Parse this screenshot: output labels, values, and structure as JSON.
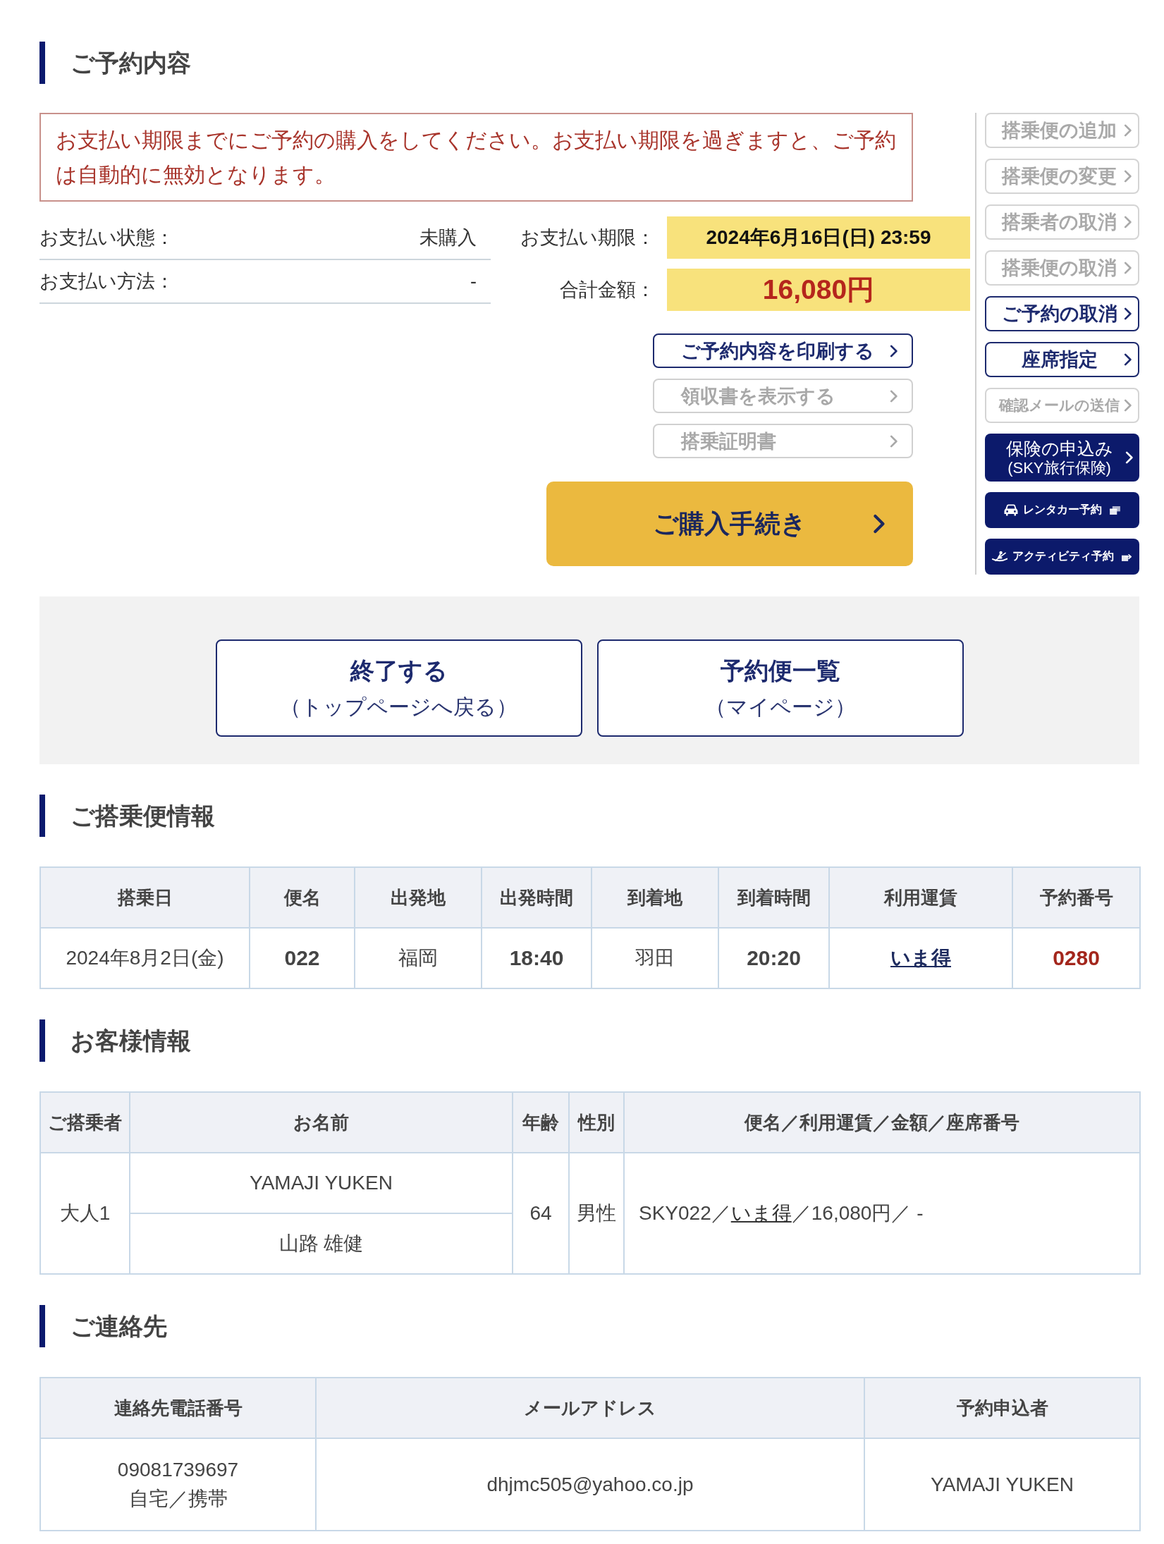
{
  "reservation": {
    "heading": "ご予約内容",
    "notice": "お支払い期限までにご予約の購入をしてください。お支払い期限を過ぎますと、ご予約は自動的に無効となります。",
    "payment_fields": [
      {
        "label": "お支払い状態：",
        "value": "未購入"
      },
      {
        "label": "お支払い方法：",
        "value": "-"
      }
    ],
    "deadline": {
      "label": "お支払い期限：",
      "value": "2024年6月16日(日) 23:59"
    },
    "total": {
      "label": "合計金額：",
      "value": "16,080円"
    },
    "document_buttons": [
      {
        "label": "ご予約内容を印刷する",
        "disabled": false
      },
      {
        "label": "領収書を表示する",
        "disabled": true
      },
      {
        "label": "搭乗証明書",
        "disabled": true
      }
    ],
    "purchase_button": {
      "label": "ご購入手続き"
    }
  },
  "side_menu": [
    {
      "kind": "outline",
      "label": "搭乗便の追加",
      "disabled": true
    },
    {
      "kind": "outline",
      "label": "搭乗便の変更",
      "disabled": true
    },
    {
      "kind": "outline",
      "label": "搭乗者の取消",
      "disabled": true
    },
    {
      "kind": "outline",
      "label": "搭乗便の取消",
      "disabled": true
    },
    {
      "kind": "outline",
      "label": "ご予約の取消",
      "disabled": false
    },
    {
      "kind": "outline",
      "label": "座席指定",
      "disabled": false
    },
    {
      "kind": "outline",
      "label": "確認メールの送信",
      "disabled": true
    },
    {
      "kind": "filled",
      "label": "保険の申込み",
      "note": "(SKY旅行保険)",
      "disabled": false
    },
    {
      "kind": "car",
      "label": "レンタカー予約",
      "disabled": false
    },
    {
      "kind": "activity",
      "label": "アクティビティ予約",
      "disabled": false
    }
  ],
  "exit_buttons": [
    {
      "title": "終了する",
      "subtitle": "（トップページへ戻る）"
    },
    {
      "title": "予約便一覧",
      "subtitle": "（マイページ）"
    }
  ],
  "flight_info": {
    "heading": "ご搭乗便情報",
    "columns": [
      "搭乗日",
      "便名",
      "出発地",
      "出発時間",
      "到着地",
      "到着時間",
      "利用運賃",
      "予約番号"
    ],
    "rows": [
      [
        {
          "kind": "plain",
          "text": "2024年8月2日(金)"
        },
        {
          "kind": "bold",
          "text": "022"
        },
        {
          "kind": "plain",
          "text": "福岡"
        },
        {
          "kind": "bold",
          "text": "18:40"
        },
        {
          "kind": "plain",
          "text": "羽田"
        },
        {
          "kind": "bold",
          "text": "20:20"
        },
        {
          "kind": "link",
          "text": "いま得"
        },
        {
          "kind": "accent",
          "text": "0280"
        }
      ]
    ]
  },
  "customer_info": {
    "heading": "お客様情報",
    "columns": [
      "ご搭乗者",
      "お名前",
      "年齢",
      "性別",
      "便名／利用運賃／金額／座席番号"
    ],
    "rows": [
      {
        "passenger": "大人1",
        "names": [
          "YAMAJI YUKEN",
          "山路 雄健"
        ],
        "age": "64",
        "gender": "男性",
        "details": [
          {
            "kind": "plain",
            "text": "SKY022／"
          },
          {
            "kind": "link",
            "text": "いま得"
          },
          {
            "kind": "plain",
            "text": "／16,080円／ -"
          }
        ]
      }
    ]
  },
  "contact_info": {
    "heading": "ご連絡先",
    "columns": [
      "連絡先電話番号",
      "メールアドレス",
      "予約申込者"
    ],
    "rows": [
      {
        "phone": "09081739697",
        "phone_type": "自宅／携帯",
        "email": "dhjmc505@yahoo.co.jp",
        "applicant": "YAMAJI YUKEN"
      }
    ]
  }
}
